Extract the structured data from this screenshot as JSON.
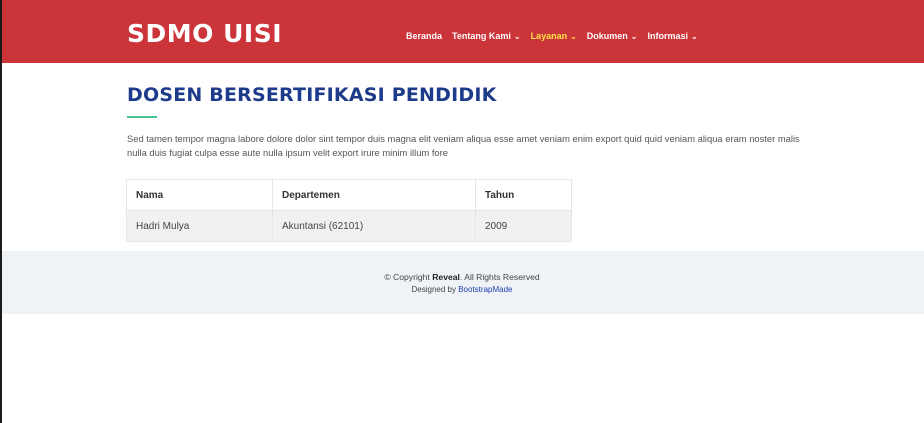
{
  "brand": "SDMO UISI",
  "nav": [
    {
      "label": "Beranda",
      "dropdown": false,
      "active": false
    },
    {
      "label": "Tentang Kami",
      "dropdown": true,
      "active": false
    },
    {
      "label": "Layanan",
      "dropdown": true,
      "active": true
    },
    {
      "label": "Dokumen",
      "dropdown": true,
      "active": false
    },
    {
      "label": "Informasi",
      "dropdown": true,
      "active": false
    }
  ],
  "colors": {
    "header": "#cb3439",
    "title": "#1e3a8a",
    "accent": "#49c58f",
    "active_nav": "#ffe24a"
  },
  "page_title": "DOSEN BERSERTIFIKASI PENDIDIK",
  "description": "Sed tamen tempor magna labore dolore dolor sint tempor duis magna elit veniam aliqua esse amet veniam enim export quid quid veniam aliqua eram noster malis nulla duis fugiat culpa esse aute nulla ipsum velit export irure minim illum fore",
  "table": {
    "headers": [
      "Nama",
      "Departemen",
      "Tahun"
    ],
    "rows": [
      [
        "Hadri Mulya",
        "Akuntansi (62101)",
        "2009"
      ]
    ]
  },
  "footer": {
    "copyright_prefix": "© Copyright ",
    "copyright_brand": "Reveal",
    "copyright_suffix": ". All Rights Reserved",
    "designed_by": "Designed by ",
    "designer_link": "BootstrapMade"
  }
}
